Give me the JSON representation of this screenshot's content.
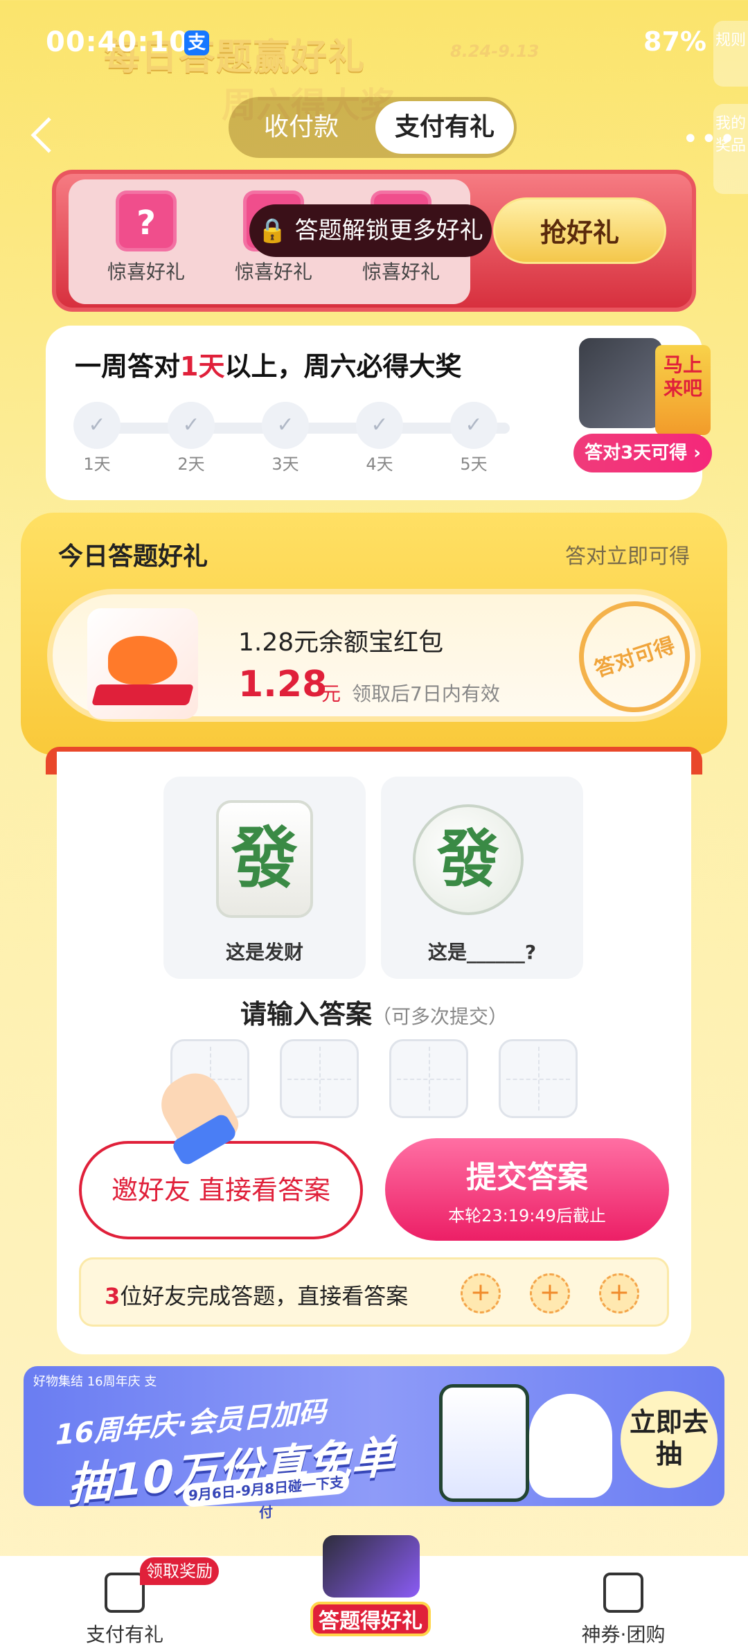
{
  "status": {
    "time": "00:40:10",
    "battery": "87%",
    "app_icon": "支"
  },
  "banner": {
    "title": "每日答题赢好礼",
    "sub": "周六得大奖",
    "date": "8.24-9.13"
  },
  "nav": {
    "tabs": [
      "收付款",
      "支付有礼"
    ],
    "side_tab_1": "规则",
    "side_tab_2": "我的奖品"
  },
  "gifts": {
    "items": [
      "惊喜好礼",
      "惊喜好礼",
      "惊喜好礼"
    ],
    "lock_text": "答题解锁更多好礼",
    "grab_button": "抢好礼"
  },
  "weekly": {
    "title_pre": "一周答对",
    "title_num": "1天",
    "title_post": "以上，周六必得大奖",
    "days": [
      "1天",
      "2天",
      "3天",
      "4天",
      "5天"
    ],
    "badge": "答对3天可得 ›",
    "card_text": "马上来吧"
  },
  "today": {
    "title": "今日答题好礼",
    "subtitle": "答对立即可得",
    "reward_name": "1.28元余额宝红包",
    "reward_value": "1.28",
    "reward_unit": "元",
    "reward_valid": "领取后7日内有效",
    "stamp": "答对可得"
  },
  "quiz": {
    "q1_char": "發",
    "q1_label": "这是发财",
    "q2_char": "發",
    "q2_label": "这是______?",
    "prompt": "请输入答案",
    "prompt_note": "（可多次提交）",
    "invite_button": "邀好友 直接看答案",
    "submit_button": "提交答案",
    "deadline": "本轮23:19:49后截止",
    "friends_num": "3",
    "friends_text": "位好友完成答题，直接看答案"
  },
  "promo": {
    "top": "好物集结  16周年庆  支",
    "line1": "16周年庆·会员日加码",
    "line2": "抽10万份真免单",
    "pill": "9月6日-9月8日碰一下支付",
    "button": "立即去抽"
  },
  "tabbar": {
    "left": "支付有礼",
    "badge": "领取奖励",
    "center": "答题得好礼",
    "right": "神券·团购"
  }
}
